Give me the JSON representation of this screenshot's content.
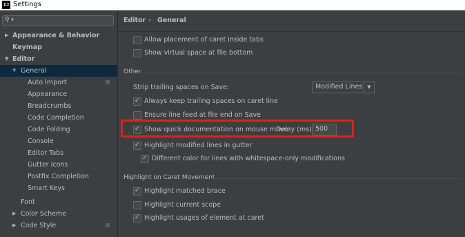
{
  "window": {
    "title": "Settings",
    "app_icon": "IJ"
  },
  "search": {
    "placeholder": ""
  },
  "sidebar": {
    "items": [
      {
        "label": "Appearance & Behavior"
      },
      {
        "label": "Keymap"
      },
      {
        "label": "Editor"
      },
      {
        "label": "General"
      },
      {
        "label": "Auto Import"
      },
      {
        "label": "Appearance"
      },
      {
        "label": "Breadcrumbs"
      },
      {
        "label": "Code Completion"
      },
      {
        "label": "Code Folding"
      },
      {
        "label": "Console"
      },
      {
        "label": "Editor Tabs"
      },
      {
        "label": "Gutter Icons"
      },
      {
        "label": "Postfix Completion"
      },
      {
        "label": "Smart Keys"
      },
      {
        "label": "Font"
      },
      {
        "label": "Color Scheme"
      },
      {
        "label": "Code Style"
      }
    ]
  },
  "breadcrumb": {
    "parent": "Editor",
    "separator": "›",
    "current": "General"
  },
  "options": {
    "caret_inside_tabs": "Allow placement of caret inside tabs",
    "virtual_space": "Show virtual space at file bottom"
  },
  "other": {
    "title": "Other",
    "strip_label": "Strip trailing spaces on Save:",
    "strip_value": "Modified Lines",
    "keep_trailing": "Always keep trailing spaces on caret line",
    "ensure_lf": "Ensure line feed at file end on Save",
    "quick_doc": "Show quick documentation on mouse move",
    "delay_label": "Delay (ms):",
    "delay_value": "500",
    "highlight_modified": "Highlight modified lines in gutter",
    "different_color": "Different color for lines with whitespace-only modifications"
  },
  "caret": {
    "title": "Highlight on Caret Movement",
    "matched_brace": "Highlight matched brace",
    "current_scope": "Highlight current scope",
    "usages": "Highlight usages of element at caret"
  },
  "colors": {
    "selection": "#0d293e",
    "highlight_box": "#e02020"
  }
}
